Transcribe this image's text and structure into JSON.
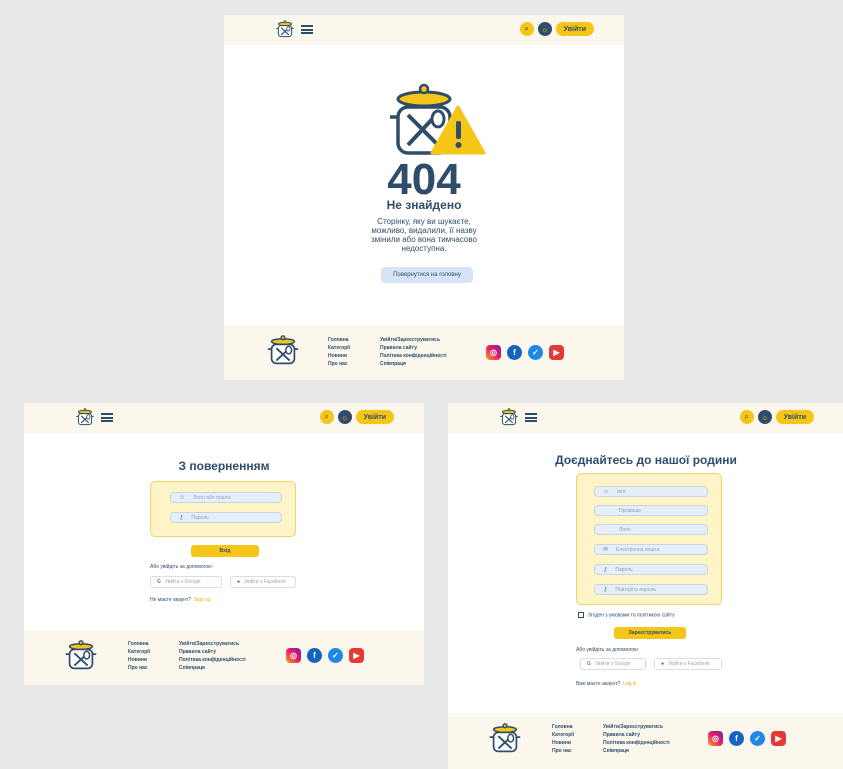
{
  "common": {
    "login_button": "Увійти",
    "footer_links_col1": [
      "Головна",
      "Категорії",
      "Новини",
      "Про нас"
    ],
    "footer_links_col2": [
      "Увійти/Зареєструватись",
      "Правила сайту",
      "Політика конфіденційності",
      "Співпраця"
    ],
    "colors": {
      "accent": "#f5c518",
      "primary": "#2f4d6b",
      "light_bg": "#fbf7ec"
    }
  },
  "page404": {
    "code": "404",
    "title": "Не знайдено",
    "message_lines": [
      "Сторінку, яку ви шукаєте,",
      "можливо, видалили, її назву",
      "змінили або вона тимчасово",
      "недоступна."
    ],
    "home_button": "Повернутися на головну"
  },
  "login": {
    "title": "З поверненням",
    "login_placeholder": "Логін або пошта",
    "password_placeholder": "Пароль",
    "submit": "Вхід",
    "alt_text": "Або увійдіть за допомогою",
    "google": "Увійти з Google",
    "facebook": "Увійти з Facebook",
    "no_account": "Не маєте акаунт?",
    "signup_link": "Sign up"
  },
  "register": {
    "title": "Доєднайтесь до нашої родини",
    "name_placeholder": "Ім'я",
    "surname_placeholder": "Прізвище",
    "login_placeholder": "Логін",
    "email_placeholder": "Електронна пошта",
    "password_placeholder": "Пароль",
    "repeat_placeholder": "Повторіть пароль",
    "agree_text": "Згоден з умовами та політикою сайту",
    "submit": "Зареєструватись",
    "alt_text": "Або увійдіть за допомогою",
    "google": "Увійти з Google",
    "facebook": "Увійти з Facebook",
    "have_account": "Вже маєте акаунт?",
    "login_link": "Log in"
  }
}
